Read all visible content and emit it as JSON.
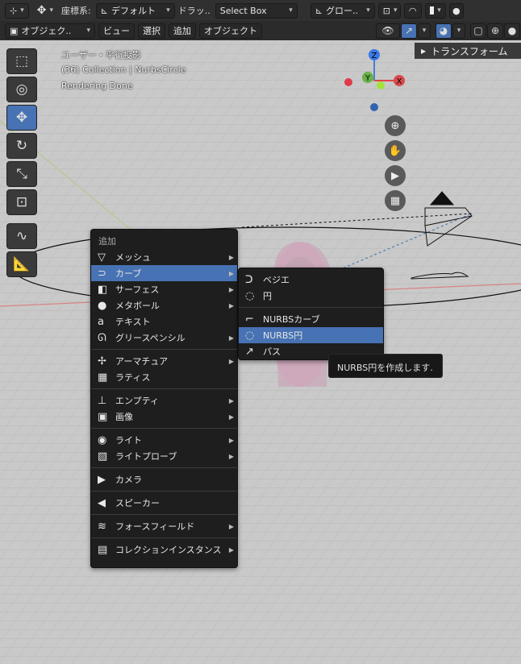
{
  "header": {
    "pivot_icon": "pivot-icon",
    "transform_icon": "transform-icon",
    "coord_label": "座標系:",
    "coord_value": "デフォルト",
    "drag_label": "ドラッ..",
    "drag_value": "Select Box",
    "orientation_value": "グロー..",
    "snap_icon": "snap-icon",
    "proportional_icon": "proportional-icon"
  },
  "header2": {
    "mode_label": "オブジェク..",
    "menus": [
      "ビュー",
      "選択",
      "追加",
      "オブジェクト"
    ]
  },
  "viewport_info": {
    "line1": "ユーザー・平行投影",
    "line2": "(36) Collection | NurbsCircle",
    "line3": "Rendering Done"
  },
  "gizmo": {
    "z": "Z",
    "y": "Y",
    "x": "X"
  },
  "npanel": {
    "transform_tab": "トランスフォーム"
  },
  "add_menu": {
    "title": "追加",
    "groups": [
      [
        {
          "label": "メッシュ",
          "icon": "mesh-icon",
          "glyph": "▽",
          "submenu": true
        },
        {
          "label": "カーブ",
          "icon": "curve-icon",
          "glyph": "⊃",
          "submenu": true,
          "selected": true
        },
        {
          "label": "サーフェス",
          "icon": "surface-icon",
          "glyph": "◧",
          "submenu": true
        },
        {
          "label": "メタボール",
          "icon": "metaball-icon",
          "glyph": "●",
          "submenu": true
        },
        {
          "label": "テキスト",
          "icon": "text-icon",
          "glyph": "a",
          "submenu": false
        },
        {
          "label": "グリースペンシル",
          "icon": "grease-pencil-icon",
          "glyph": "ᘏ",
          "submenu": true
        }
      ],
      [
        {
          "label": "アーマチュア",
          "icon": "armature-icon",
          "glyph": "✢",
          "submenu": true
        },
        {
          "label": "ラティス",
          "icon": "lattice-icon",
          "glyph": "▦",
          "submenu": false
        }
      ],
      [
        {
          "label": "エンプティ",
          "icon": "empty-icon",
          "glyph": "⊥",
          "submenu": true
        },
        {
          "label": "画像",
          "icon": "image-icon",
          "glyph": "▣",
          "submenu": true
        }
      ],
      [
        {
          "label": "ライト",
          "icon": "light-icon",
          "glyph": "◉",
          "submenu": true
        },
        {
          "label": "ライトプローブ",
          "icon": "light-probe-icon",
          "glyph": "▨",
          "submenu": true
        }
      ],
      [
        {
          "label": "カメラ",
          "icon": "camera-icon",
          "glyph": "▶",
          "submenu": false
        }
      ],
      [
        {
          "label": "スピーカー",
          "icon": "speaker-icon",
          "glyph": "◀",
          "submenu": false
        }
      ],
      [
        {
          "label": "フォースフィールド",
          "icon": "force-field-icon",
          "glyph": "≋",
          "submenu": true
        }
      ],
      [
        {
          "label": "コレクションインスタンス",
          "icon": "collection-instance-icon",
          "glyph": "▤",
          "submenu": true
        }
      ]
    ]
  },
  "curve_submenu": {
    "groups": [
      [
        {
          "label": "ベジエ",
          "icon": "bezier-icon",
          "glyph": "ᑐ"
        },
        {
          "label": "円",
          "icon": "circle-curve-icon",
          "glyph": "◌"
        }
      ],
      [
        {
          "label": "NURBSカーブ",
          "icon": "nurbs-curve-icon",
          "glyph": "⌐"
        },
        {
          "label": "NURBS円",
          "icon": "nurbs-circle-icon",
          "glyph": "◌",
          "selected": true
        },
        {
          "label": "パス",
          "icon": "path-icon",
          "glyph": "↗"
        }
      ]
    ]
  },
  "tooltip": {
    "text": "NURBS円を作成します."
  },
  "tools": [
    {
      "name": "select-box-tool",
      "glyph": "⬚"
    },
    {
      "name": "cursor-tool",
      "glyph": "◎"
    },
    {
      "name": "move-tool",
      "glyph": "✥",
      "active": true
    },
    {
      "name": "rotate-tool",
      "glyph": "↻"
    },
    {
      "name": "scale-tool",
      "glyph": "⤡"
    },
    {
      "name": "transform-tool",
      "glyph": "⊡"
    },
    {
      "name": "annotate-tool",
      "glyph": "∿"
    },
    {
      "name": "measure-tool",
      "glyph": "📐"
    }
  ]
}
